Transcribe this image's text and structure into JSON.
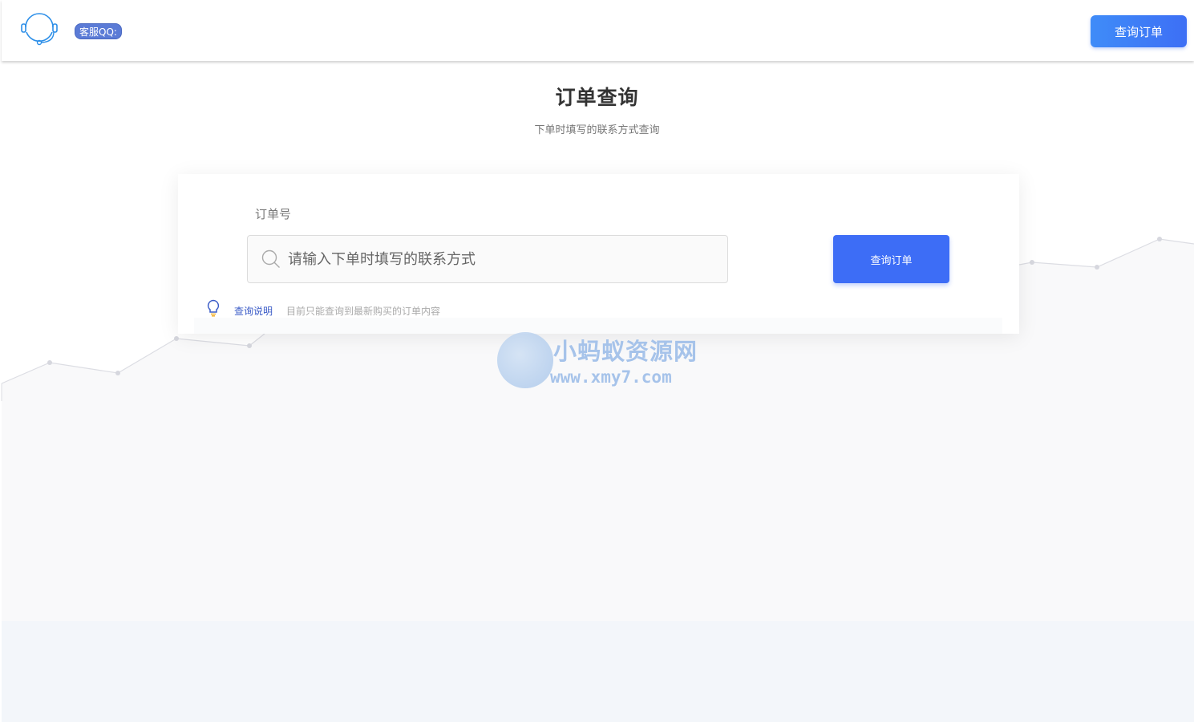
{
  "header": {
    "qq_label": "客服QQ:",
    "query_button": "查询订单"
  },
  "main": {
    "title": "订单查询",
    "subtitle": "下单时填写的联系方式查询"
  },
  "form": {
    "field_label": "订单号",
    "placeholder": "请输入下单时填写的联系方式",
    "submit_label": "查询订单",
    "hint_title": "查询说明",
    "hint_text": "目前只能查询到最新购买的订单内容"
  },
  "watermark": {
    "name": "小蚂蚁资源网",
    "url": "www.xmy7.com"
  },
  "colors": {
    "accent": "#3d6df6",
    "qq_badge": "#5b7bd6",
    "footer": "#f3f6fa"
  },
  "icons": {
    "logo": "headset-icon",
    "search": "search-icon",
    "hint": "lightbulb-icon"
  }
}
